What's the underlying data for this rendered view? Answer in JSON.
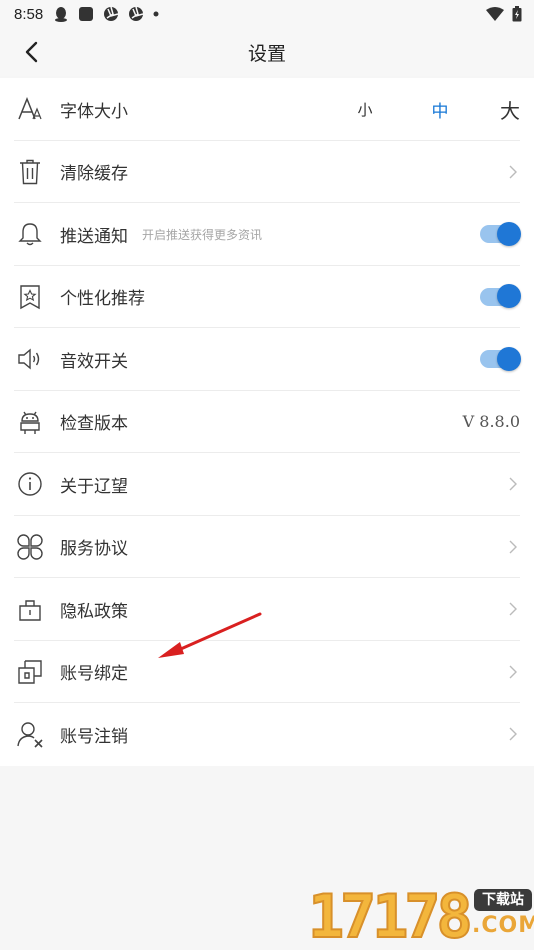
{
  "status_bar": {
    "time": "8:58",
    "left_icons": [
      "qq-icon",
      "app-square-icon",
      "aperture-icon",
      "aperture-icon",
      "dot-icon"
    ],
    "right_icons": [
      "wifi-icon",
      "battery-icon"
    ]
  },
  "header": {
    "title": "设置",
    "back_icon": "chevron-left-icon"
  },
  "settings": {
    "font_size": {
      "label": "字体大小",
      "small": "小",
      "medium": "中",
      "large": "大",
      "selected": "中"
    },
    "clear_cache": {
      "label": "清除缓存"
    },
    "push": {
      "label": "推送通知",
      "hint": "开启推送获得更多资讯",
      "enabled": true
    },
    "personalized": {
      "label": "个性化推荐",
      "enabled": true
    },
    "sound": {
      "label": "音效开关",
      "enabled": true
    },
    "version": {
      "label": "检查版本",
      "value": "V 8.8.0"
    },
    "about": {
      "label": "关于辽望"
    },
    "agreement": {
      "label": "服务协议"
    },
    "privacy": {
      "label": "隐私政策"
    },
    "binding": {
      "label": "账号绑定"
    },
    "cancel_account": {
      "label": "账号注销"
    }
  },
  "colors": {
    "accent": "#1f77d6",
    "toggle_track": "#99c4ee",
    "annotation_arrow": "#d92020"
  },
  "watermark": {
    "digits": "17178",
    "badge": "下载站",
    "suffix": ".COM"
  }
}
